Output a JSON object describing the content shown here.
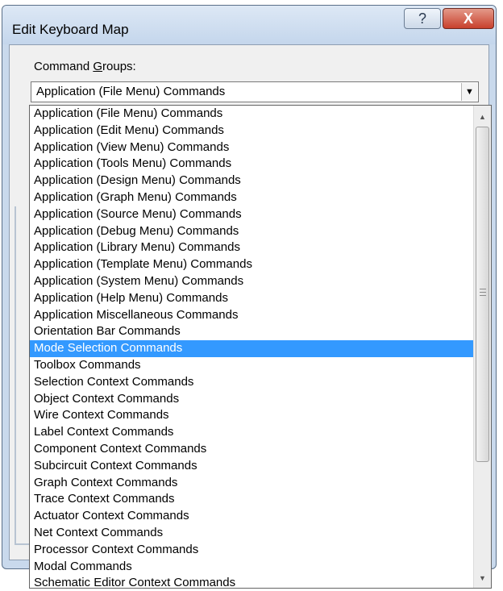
{
  "window": {
    "title": "Edit Keyboard Map",
    "help_label": "?",
    "close_label": "X"
  },
  "command_groups": {
    "label_prefix": "Command ",
    "label_accel": "G",
    "label_suffix": "roups:",
    "selected_value": "Application (File Menu) Commands",
    "dropdown_arrow": "▼",
    "highlighted_item": "Mode Selection Commands",
    "items": [
      "Application (File Menu) Commands",
      "Application (Edit Menu) Commands",
      "Application (View Menu) Commands",
      "Application (Tools Menu) Commands",
      "Application (Design Menu) Commands",
      "Application (Graph Menu) Commands",
      "Application (Source Menu) Commands",
      "Application (Debug Menu) Commands",
      "Application (Library Menu) Commands",
      "Application (Template Menu) Commands",
      "Application (System Menu) Commands",
      "Application (Help Menu) Commands",
      "Application Miscellaneous Commands",
      "Orientation Bar Commands",
      "Mode Selection Commands",
      "Toolbox Commands",
      "Selection Context Commands",
      "Object Context Commands",
      "Wire Context Commands",
      "Label Context Commands",
      "Component Context Commands",
      "Subcircuit Context Commands",
      "Graph Context Commands",
      "Trace Context Commands",
      "Actuator Context Commands",
      "Net Context Commands",
      "Processor Context Commands",
      "Modal Commands",
      "Schematic Editor Context Commands"
    ]
  },
  "scrollbar": {
    "up_arrow": "▲",
    "down_arrow": "▼"
  },
  "colors": {
    "selection": "#3399ff",
    "close_button": "#c8402c",
    "frame": "#c9d9ec"
  }
}
